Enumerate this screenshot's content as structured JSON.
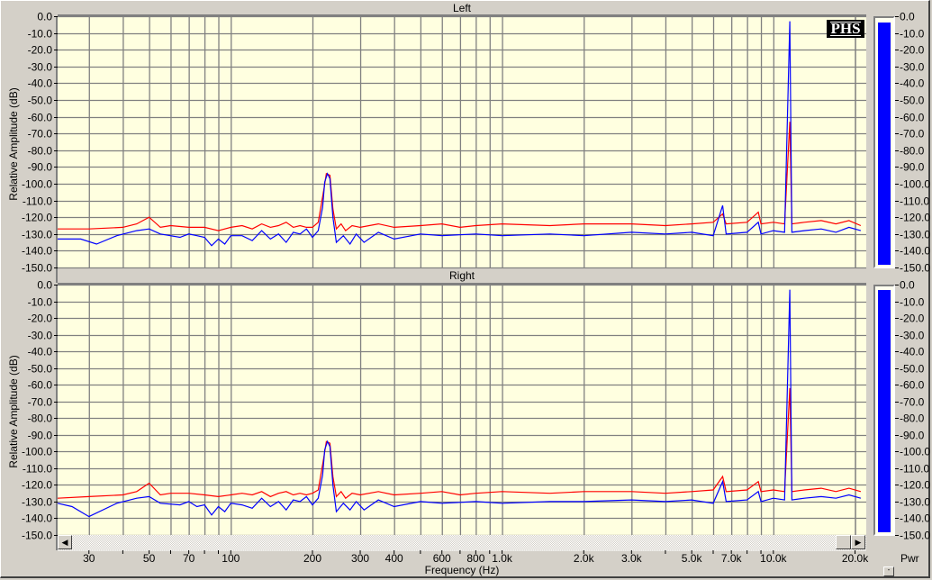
{
  "x_axis": {
    "label": "Frequency (Hz)",
    "ticks": [
      "30",
      "50",
      "70",
      "100",
      "200",
      "300",
      "400",
      "600",
      "800",
      "1.0k",
      "2.0k",
      "3.0k",
      "5.0k",
      "7.0k",
      "10.0k",
      "20.0k"
    ],
    "tick_values": [
      30,
      50,
      70,
      100,
      200,
      300,
      400,
      600,
      800,
      1000,
      2000,
      3000,
      5000,
      7000,
      10000,
      20000
    ]
  },
  "logo": "PHS",
  "meter": {
    "label": "Pwr",
    "minimize": "-",
    "left_level_db": -3,
    "right_level_db": -3
  },
  "scroll": {
    "left": "◀",
    "right": "▶"
  },
  "colors": {
    "plot_bg": "#ffffe0",
    "grid": "#808080",
    "ch1": "#ff0000",
    "ch2": "#0000ff"
  },
  "chart_data": {
    "type": "line",
    "xscale": "log",
    "xlim": [
      23,
      22000
    ],
    "ylim": [
      -150,
      0
    ],
    "xlabel": "Frequency (Hz)",
    "ylabel": "Relative Amplitude (dB)",
    "yticks": [
      "0.0",
      "-10.0",
      "-20.0",
      "-30.0",
      "-40.0",
      "-50.0",
      "-60.0",
      "-70.0",
      "-80.0",
      "-90.0",
      "-100.0",
      "-110.0",
      "-120.0",
      "-130.0",
      "-140.0",
      "-150.0"
    ],
    "grid": true,
    "channels": [
      {
        "title": "Left",
        "series": [
          {
            "name": "red",
            "color": "#ff0000",
            "points": [
              [
                23,
                -127
              ],
              [
                30,
                -127
              ],
              [
                40,
                -126
              ],
              [
                45,
                -124
              ],
              [
                50,
                -120
              ],
              [
                55,
                -126
              ],
              [
                60,
                -125
              ],
              [
                70,
                -126
              ],
              [
                80,
                -126
              ],
              [
                90,
                -128
              ],
              [
                100,
                -126
              ],
              [
                110,
                -125
              ],
              [
                120,
                -127
              ],
              [
                130,
                -124
              ],
              [
                140,
                -126
              ],
              [
                150,
                -125
              ],
              [
                160,
                -123
              ],
              [
                170,
                -126
              ],
              [
                180,
                -125
              ],
              [
                190,
                -126
              ],
              [
                200,
                -126
              ],
              [
                210,
                -123
              ],
              [
                220,
                -104
              ],
              [
                225,
                -94
              ],
              [
                232,
                -95
              ],
              [
                238,
                -115
              ],
              [
                245,
                -127
              ],
              [
                255,
                -124
              ],
              [
                265,
                -128
              ],
              [
                280,
                -125
              ],
              [
                300,
                -126
              ],
              [
                350,
                -124
              ],
              [
                400,
                -126
              ],
              [
                500,
                -125
              ],
              [
                600,
                -124
              ],
              [
                700,
                -126
              ],
              [
                800,
                -125
              ],
              [
                1000,
                -124
              ],
              [
                1500,
                -125
              ],
              [
                2000,
                -124
              ],
              [
                3000,
                -124
              ],
              [
                4000,
                -125
              ],
              [
                5000,
                -124
              ],
              [
                6000,
                -123
              ],
              [
                6500,
                -118
              ],
              [
                6700,
                -124
              ],
              [
                8000,
                -123
              ],
              [
                8800,
                -117
              ],
              [
                9000,
                -124
              ],
              [
                10000,
                -123
              ],
              [
                11000,
                -124
              ],
              [
                11500,
                -63
              ],
              [
                11700,
                -124
              ],
              [
                13000,
                -123
              ],
              [
                15000,
                -122
              ],
              [
                17000,
                -124
              ],
              [
                19000,
                -122
              ],
              [
                21000,
                -125
              ]
            ]
          },
          {
            "name": "blue",
            "color": "#0000ff",
            "points": [
              [
                23,
                -133
              ],
              [
                28,
                -133
              ],
              [
                32,
                -136
              ],
              [
                38,
                -131
              ],
              [
                45,
                -128
              ],
              [
                50,
                -127
              ],
              [
                55,
                -130
              ],
              [
                65,
                -132
              ],
              [
                70,
                -130
              ],
              [
                75,
                -131
              ],
              [
                80,
                -132
              ],
              [
                85,
                -137
              ],
              [
                90,
                -133
              ],
              [
                95,
                -136
              ],
              [
                100,
                -131
              ],
              [
                110,
                -131
              ],
              [
                120,
                -134
              ],
              [
                130,
                -128
              ],
              [
                140,
                -133
              ],
              [
                150,
                -130
              ],
              [
                160,
                -135
              ],
              [
                170,
                -129
              ],
              [
                180,
                -130
              ],
              [
                190,
                -127
              ],
              [
                200,
                -132
              ],
              [
                210,
                -128
              ],
              [
                218,
                -114
              ],
              [
                222,
                -99
              ],
              [
                227,
                -94
              ],
              [
                232,
                -97
              ],
              [
                238,
                -120
              ],
              [
                245,
                -135
              ],
              [
                260,
                -131
              ],
              [
                275,
                -136
              ],
              [
                290,
                -130
              ],
              [
                310,
                -135
              ],
              [
                350,
                -129
              ],
              [
                400,
                -133
              ],
              [
                500,
                -130
              ],
              [
                600,
                -131
              ],
              [
                800,
                -130
              ],
              [
                1000,
                -131
              ],
              [
                1500,
                -130
              ],
              [
                2000,
                -131
              ],
              [
                3000,
                -129
              ],
              [
                4000,
                -130
              ],
              [
                5000,
                -129
              ],
              [
                6000,
                -131
              ],
              [
                6500,
                -113
              ],
              [
                6700,
                -130
              ],
              [
                8000,
                -129
              ],
              [
                8800,
                -123
              ],
              [
                9000,
                -130
              ],
              [
                10000,
                -128
              ],
              [
                11000,
                -129
              ],
              [
                11500,
                -3
              ],
              [
                11700,
                -129
              ],
              [
                13000,
                -128
              ],
              [
                15000,
                -127
              ],
              [
                17000,
                -129
              ],
              [
                19000,
                -126
              ],
              [
                21000,
                -128
              ]
            ]
          }
        ]
      },
      {
        "title": "Right",
        "series": [
          {
            "name": "red",
            "color": "#ff0000",
            "points": [
              [
                23,
                -128
              ],
              [
                30,
                -127
              ],
              [
                40,
                -126
              ],
              [
                45,
                -124
              ],
              [
                50,
                -119
              ],
              [
                55,
                -126
              ],
              [
                60,
                -125
              ],
              [
                70,
                -125
              ],
              [
                80,
                -126
              ],
              [
                90,
                -127
              ],
              [
                100,
                -126
              ],
              [
                110,
                -125
              ],
              [
                120,
                -126
              ],
              [
                130,
                -124
              ],
              [
                140,
                -127
              ],
              [
                150,
                -125
              ],
              [
                160,
                -124
              ],
              [
                170,
                -126
              ],
              [
                180,
                -125
              ],
              [
                190,
                -126
              ],
              [
                200,
                -125
              ],
              [
                210,
                -123
              ],
              [
                220,
                -104
              ],
              [
                225,
                -94
              ],
              [
                232,
                -95
              ],
              [
                238,
                -115
              ],
              [
                245,
                -127
              ],
              [
                255,
                -124
              ],
              [
                265,
                -128
              ],
              [
                280,
                -125
              ],
              [
                300,
                -126
              ],
              [
                350,
                -124
              ],
              [
                400,
                -126
              ],
              [
                500,
                -125
              ],
              [
                600,
                -124
              ],
              [
                700,
                -126
              ],
              [
                800,
                -125
              ],
              [
                1000,
                -124
              ],
              [
                1500,
                -125
              ],
              [
                2000,
                -124
              ],
              [
                3000,
                -124
              ],
              [
                4000,
                -125
              ],
              [
                5000,
                -124
              ],
              [
                6000,
                -123
              ],
              [
                6500,
                -115
              ],
              [
                6700,
                -124
              ],
              [
                8000,
                -123
              ],
              [
                8800,
                -118
              ],
              [
                9000,
                -124
              ],
              [
                10000,
                -123
              ],
              [
                11000,
                -124
              ],
              [
                11500,
                -62
              ],
              [
                11700,
                -124
              ],
              [
                13000,
                -123
              ],
              [
                15000,
                -122
              ],
              [
                17000,
                -124
              ],
              [
                19000,
                -122
              ],
              [
                21000,
                -124
              ]
            ]
          },
          {
            "name": "blue",
            "color": "#0000ff",
            "points": [
              [
                23,
                -131
              ],
              [
                26,
                -133
              ],
              [
                30,
                -139
              ],
              [
                38,
                -131
              ],
              [
                45,
                -128
              ],
              [
                50,
                -127
              ],
              [
                55,
                -131
              ],
              [
                65,
                -132
              ],
              [
                70,
                -130
              ],
              [
                75,
                -133
              ],
              [
                80,
                -132
              ],
              [
                85,
                -138
              ],
              [
                90,
                -133
              ],
              [
                95,
                -136
              ],
              [
                100,
                -131
              ],
              [
                110,
                -132
              ],
              [
                120,
                -134
              ],
              [
                130,
                -128
              ],
              [
                140,
                -133
              ],
              [
                150,
                -130
              ],
              [
                160,
                -135
              ],
              [
                170,
                -129
              ],
              [
                180,
                -130
              ],
              [
                190,
                -127
              ],
              [
                200,
                -132
              ],
              [
                210,
                -128
              ],
              [
                218,
                -114
              ],
              [
                222,
                -99
              ],
              [
                227,
                -94
              ],
              [
                232,
                -97
              ],
              [
                238,
                -120
              ],
              [
                245,
                -136
              ],
              [
                260,
                -131
              ],
              [
                275,
                -135
              ],
              [
                290,
                -130
              ],
              [
                310,
                -135
              ],
              [
                350,
                -129
              ],
              [
                400,
                -133
              ],
              [
                500,
                -130
              ],
              [
                600,
                -131
              ],
              [
                800,
                -130
              ],
              [
                1000,
                -131
              ],
              [
                1500,
                -130
              ],
              [
                2000,
                -130
              ],
              [
                3000,
                -129
              ],
              [
                4000,
                -130
              ],
              [
                5000,
                -129
              ],
              [
                6000,
                -131
              ],
              [
                6500,
                -118
              ],
              [
                6700,
                -130
              ],
              [
                8000,
                -129
              ],
              [
                8800,
                -124
              ],
              [
                9000,
                -130
              ],
              [
                10000,
                -128
              ],
              [
                11000,
                -129
              ],
              [
                11500,
                -3
              ],
              [
                11700,
                -129
              ],
              [
                13000,
                -128
              ],
              [
                15000,
                -127
              ],
              [
                17000,
                -128
              ],
              [
                19000,
                -126
              ],
              [
                21000,
                -128
              ]
            ]
          }
        ]
      }
    ]
  }
}
